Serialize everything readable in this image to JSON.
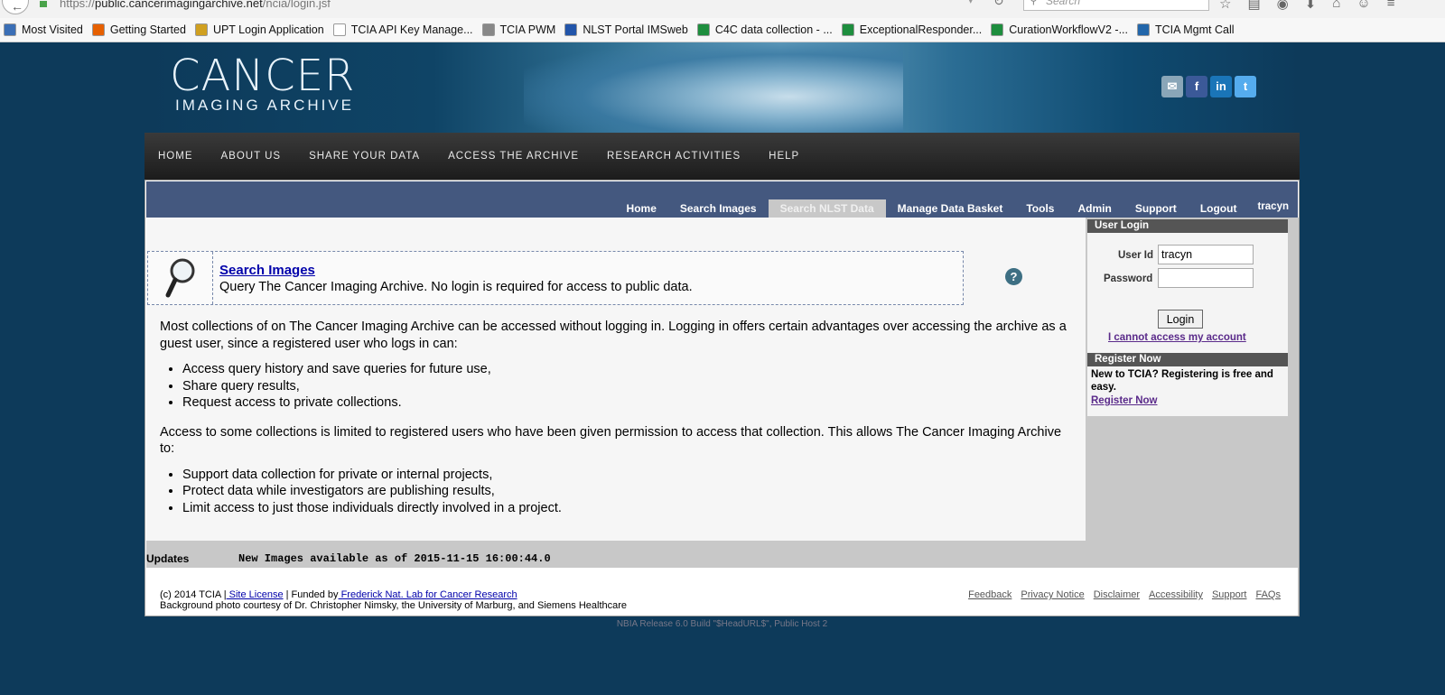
{
  "browser": {
    "url_domain": "public.cancerimagingarchive.net",
    "url_prefix": "https://",
    "url_path": "/ncia/login.jsf",
    "search_placeholder": "Search",
    "bookmarks": [
      {
        "label": "Most Visited",
        "icon": "star-folder-icon",
        "color": "#3b6fb6"
      },
      {
        "label": "Getting Started",
        "icon": "firefox-icon",
        "color": "#e66000"
      },
      {
        "label": "UPT Login Application",
        "icon": "spinner-icon",
        "color": "#d0a020"
      },
      {
        "label": "TCIA API Key Manage...",
        "icon": "page-icon",
        "color": "#ffffff"
      },
      {
        "label": "TCIA PWM",
        "icon": "key-icon",
        "color": "#888888"
      },
      {
        "label": "NLST Portal IMSweb",
        "icon": "ims-icon",
        "color": "#2255aa"
      },
      {
        "label": "C4C data collection - ...",
        "icon": "sheet-icon",
        "color": "#1e8e3e"
      },
      {
        "label": "ExceptionalResponder...",
        "icon": "sheet-icon",
        "color": "#1e8e3e"
      },
      {
        "label": "CurationWorkflowV2 -...",
        "icon": "sheet-icon",
        "color": "#1e8e3e"
      },
      {
        "label": "TCIA Mgmt Call",
        "icon": "x-icon",
        "color": "#2266aa"
      }
    ]
  },
  "site": {
    "logo_line1": "CANCER",
    "logo_line2": "IMAGING ARCHIVE",
    "social": [
      {
        "icon": "email-icon",
        "glyph": "✉",
        "color": "#8aa6b8"
      },
      {
        "icon": "facebook-icon",
        "glyph": "f",
        "color": "#3b5998"
      },
      {
        "icon": "linkedin-icon",
        "glyph": "in",
        "color": "#1a75b8"
      },
      {
        "icon": "twitter-icon",
        "glyph": "t",
        "color": "#55acee"
      }
    ],
    "main_nav": [
      "HOME",
      "ABOUT US",
      "SHARE YOUR DATA",
      "ACCESS THE ARCHIVE",
      "RESEARCH ACTIVITIES",
      "HELP"
    ]
  },
  "subnav": {
    "tabs": [
      "Home",
      "Search Images",
      "Search NLST Data",
      "Manage Data Basket",
      "Tools",
      "Admin",
      "Support",
      "Logout"
    ],
    "active_tab": "Search NLST Data",
    "user": "tracyn"
  },
  "search_box": {
    "title": "Search Images",
    "description": "Query The Cancer Imaging Archive. No login is required for access to public data."
  },
  "help_glyph": "?",
  "body": {
    "para1": "Most collections of on The Cancer Imaging Archive can be accessed without logging in. Logging in offers certain advantages over accessing the archive as a guest user, since a registered user who logs in can:",
    "list1": [
      "Access query history and save queries for future use,",
      "Share query results,",
      "Request access to private collections."
    ],
    "para2": "Access to some collections is limited to registered users who have been given permission to access that collection. This allows The Cancer Imaging Archive to:",
    "list2": [
      "Support data collection for private or internal projects,",
      "Protect data while investigators are publishing results,",
      "Limit access to just those individuals directly involved in a project."
    ]
  },
  "updates": {
    "label": "Updates",
    "message": "New Images available as of 2015-11-15 16:00:44.0"
  },
  "login": {
    "header": "User Login",
    "userid_label": "User Id",
    "userid_value": "tracyn",
    "password_label": "Password",
    "password_value": "",
    "button": "Login",
    "cannot_access": "I cannot access my account"
  },
  "register": {
    "header": "Register Now",
    "text": "New to TCIA? Registering is free and easy.",
    "link": "Register Now"
  },
  "footer": {
    "copyright": "(c) 2014 TCIA |",
    "site_license": " Site License",
    "funded_by": " | Funded by",
    "fnl": " Frederick Nat. Lab for Cancer Research",
    "photo_credit": "Background photo courtesy of Dr. Christopher Nimsky, the University of Marburg, and Siemens Healthcare",
    "links": [
      "Feedback",
      "Privacy Notice",
      "Disclaimer",
      "Accessibility",
      "Support",
      "FAQs"
    ]
  },
  "release": "NBIA Release 6.0 Build \"$HeadURL$\", Public Host 2"
}
